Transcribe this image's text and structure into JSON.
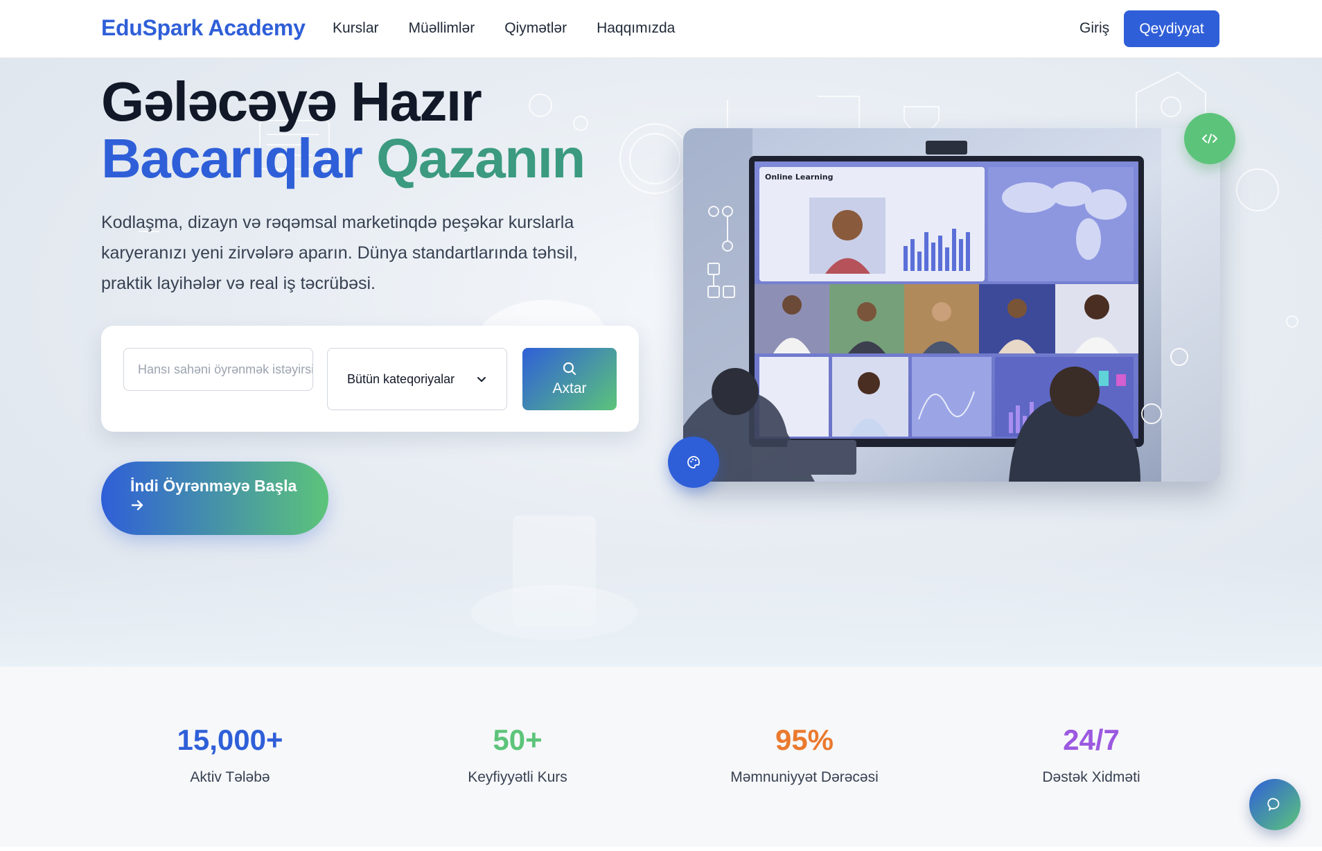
{
  "nav": {
    "logo": "EduSpark Academy",
    "links": [
      "Kurslar",
      "Müəllimlər",
      "Qiymətlər",
      "Haqqımızda"
    ],
    "login": "Giriş",
    "signup": "Qeydiyyat"
  },
  "hero": {
    "title_line1": "Gələcəyə Hazır",
    "title_word_blue": "Bacarıqlar",
    "title_word_green": "Qazanın",
    "lead": "Kodlaşma, dizayn və rəqəmsal marketinqdə peşəkar kurslarla karyeranızı yeni zirvələrə aparın. Dünya standartlarında təhsil, praktik layihələr və real iş təcrübəsi.",
    "search_placeholder": "Hansı sahəni öyrənmək istəyirsiniz?",
    "category_selected": "Bütün kateqoriyalar",
    "search_button": "Axtar",
    "cta": "İndi Öyrənməyə Başla",
    "image": {
      "screen_title": "Online Learning"
    }
  },
  "stats": [
    {
      "value": "15,000+",
      "label": "Aktiv Tələbə",
      "color": "#2f5fd8"
    },
    {
      "value": "50+",
      "label": "Keyfiyyətli Kurs",
      "color": "#5cc47a"
    },
    {
      "value": "95%",
      "label": "Məmnuniyyət Dərəcəsi",
      "color": "#ea7a2e"
    },
    {
      "value": "24/7",
      "label": "Dəstək Xidməti",
      "color": "#9b59e0"
    }
  ],
  "icons": {
    "code_badge": "code-icon",
    "palette_badge": "palette-icon",
    "search": "search-icon",
    "chevron": "chevron-down-icon",
    "arrow": "arrow-right-icon",
    "chat": "chat-icon"
  }
}
